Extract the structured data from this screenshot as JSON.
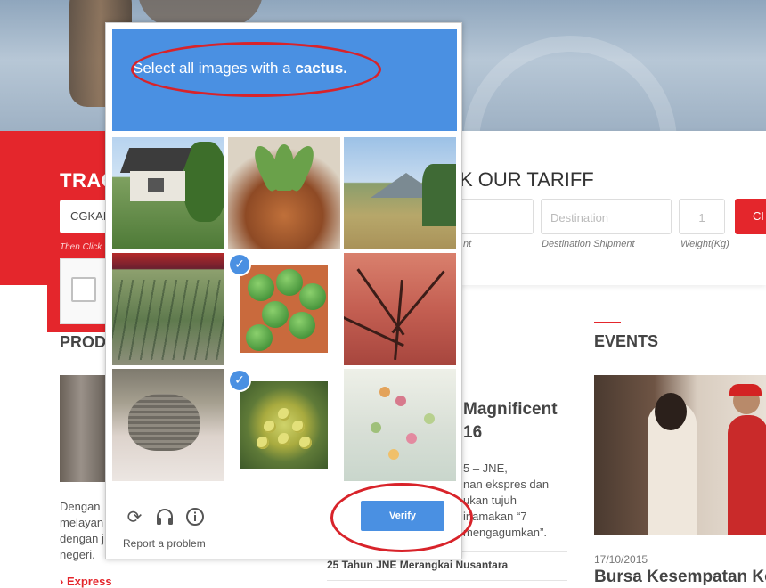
{
  "website": {
    "track": {
      "title": "TRAC",
      "input_value": "CGKAE",
      "hint": "Then Click"
    },
    "tariff": {
      "title": "K OUR TARIFF",
      "origin_sub": "nt",
      "destination_placeholder": "Destination",
      "weight_value": "1",
      "check_button": "CH",
      "destination_sub": "Destination Shipment",
      "weight_sub": "Weight(Kg)"
    },
    "products": {
      "heading": "PROD",
      "text": "Dengan ... melayan... dengan j... negeri.",
      "text_lines": [
        "Dengan",
        "melayan",
        "dengan j",
        "negeri."
      ],
      "link": "Express"
    },
    "news": {
      "title_lines": [
        "Magnificent",
        "16"
      ],
      "text_lines": [
        "5 – JNE,",
        "nan ekspres dan",
        "ukan tujuh",
        "inamakan “7",
        "mengagumkan”."
      ],
      "link": "25 Tahun JNE Merangkai Nusantara"
    },
    "events": {
      "heading": "EVENTS",
      "date": "17/10/2015",
      "title": "Bursa Kesempatan Ke"
    }
  },
  "captcha": {
    "prompt_prefix": "Select all images with a ",
    "prompt_target": "cactus.",
    "tiles": [
      {
        "subject": "house-garden",
        "selected": false
      },
      {
        "subject": "succulent-pot",
        "selected": false
      },
      {
        "subject": "mountain-valley",
        "selected": false
      },
      {
        "subject": "stadium-field",
        "selected": false
      },
      {
        "subject": "green-cactus-balls",
        "selected": true
      },
      {
        "subject": "red-tree-branches",
        "selected": false
      },
      {
        "subject": "plate-stack",
        "selected": false
      },
      {
        "subject": "romanesco",
        "selected": true
      },
      {
        "subject": "table-flowers",
        "selected": false
      }
    ],
    "icons": {
      "reload": "reload-icon",
      "audio": "headphones-icon",
      "info": "info-icon"
    },
    "report_label": "Report a problem",
    "verify_label": "Verify",
    "colors": {
      "accent": "#4a90e2",
      "annotation": "#d8232a",
      "brand_red": "#e4262c"
    }
  }
}
